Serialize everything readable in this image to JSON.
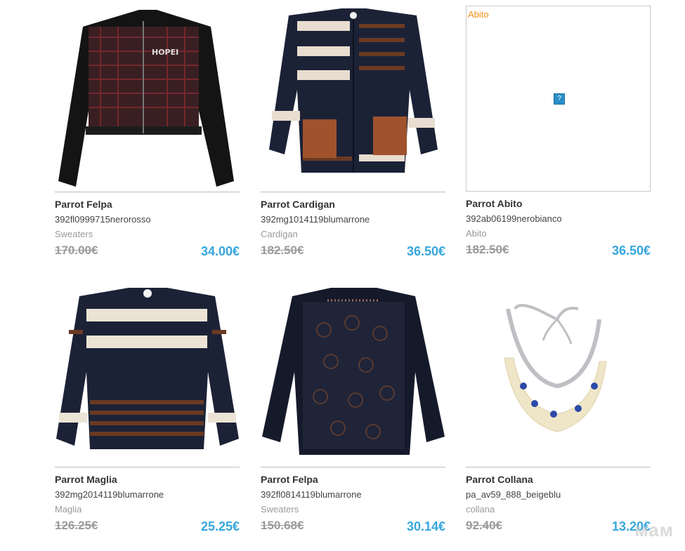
{
  "products": [
    {
      "name": "Parrot Felpa",
      "code": "392fl0999715nerorosso",
      "category": "Sweaters",
      "old_price": "170.00€",
      "new_price": "34.00€",
      "image": "black-red-tweed-jacket"
    },
    {
      "name": "Parrot Cardigan",
      "code": "392mg1014119blumarrone",
      "category": "Cardigan",
      "old_price": "182.50€",
      "new_price": "36.50€",
      "image": "striped-cardigan"
    },
    {
      "name": "Parrot Abito",
      "code": "392ab06199nerobianco",
      "category": "Abito",
      "old_price": "182.50€",
      "new_price": "36.50€",
      "image": "broken-image",
      "image_alt": "Abito"
    },
    {
      "name": "Parrot Maglia",
      "code": "392mg2014119blumarrone",
      "category": "Maglia",
      "old_price": "126.25€",
      "new_price": "25.25€",
      "image": "striped-sweater"
    },
    {
      "name": "Parrot Felpa",
      "code": "392fl0814119blumarrone",
      "category": "Sweaters",
      "old_price": "150.68€",
      "new_price": "30.14€",
      "image": "navy-lace-sweater"
    },
    {
      "name": "Parrot Collana",
      "code": "pa_av59_888_beigeblu",
      "category": "collana",
      "old_price": "92.40€",
      "new_price": "13.20€",
      "image": "beaded-collar-necklace"
    }
  ],
  "watermark": "мам",
  "colors": {
    "price_new": "#36a6dd",
    "price_old": "#9a9a9a",
    "alt_text": "#f0901d"
  }
}
